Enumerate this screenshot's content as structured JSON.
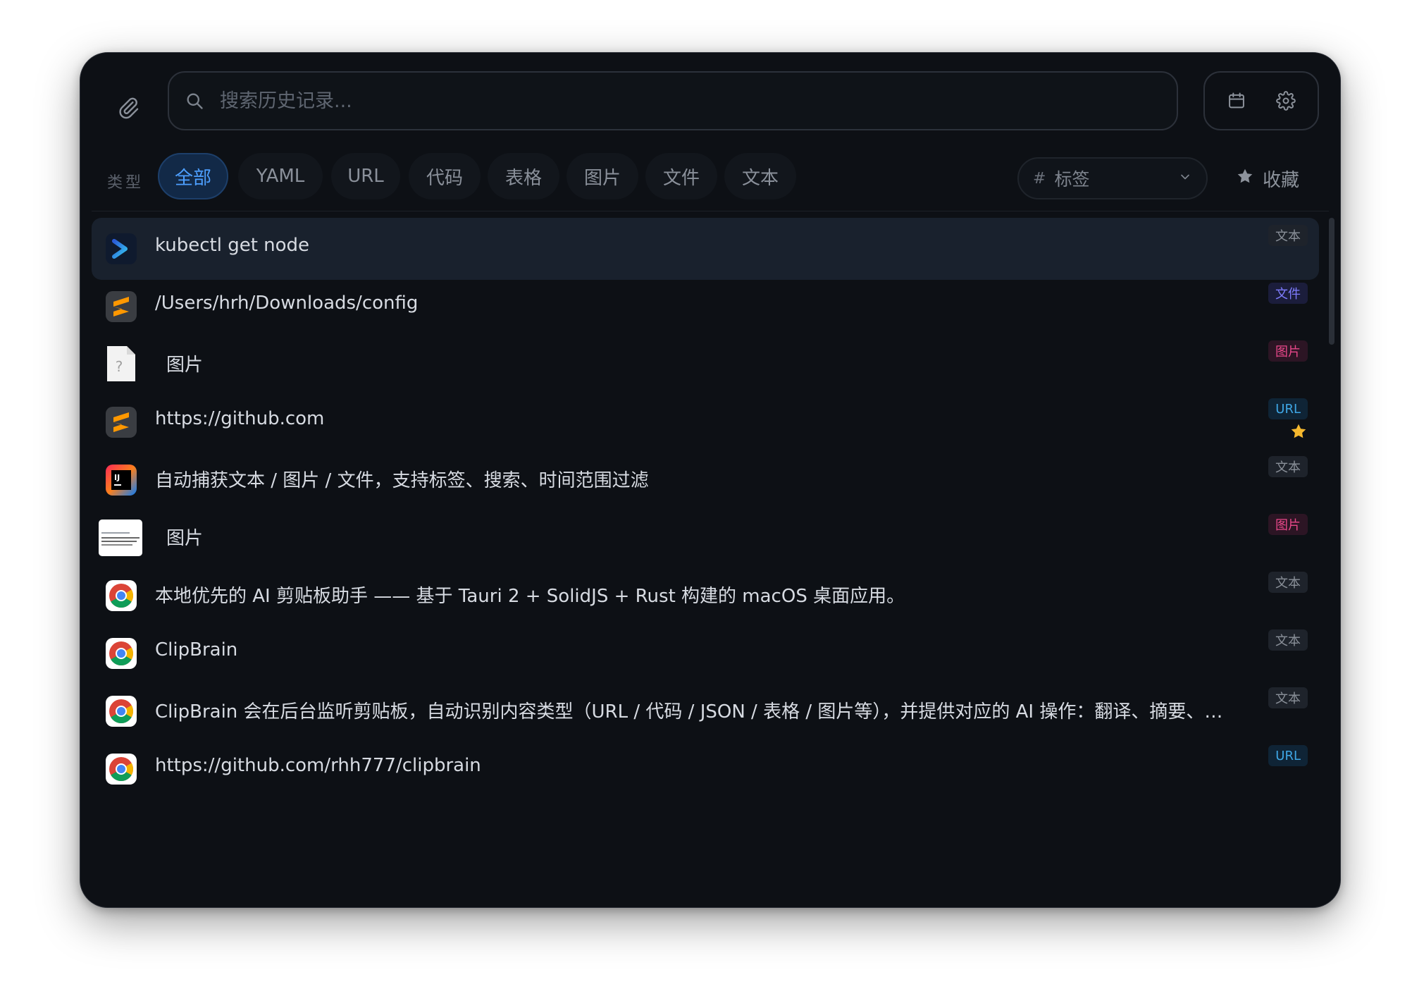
{
  "search": {
    "placeholder": "搜索历史记录..."
  },
  "filters": {
    "type_label": "类型",
    "chips": [
      "全部",
      "YAML",
      "URL",
      "代码",
      "表格",
      "图片",
      "文件",
      "文本"
    ],
    "active_index": 0,
    "tag_select_label": "标签",
    "tag_hash": "#",
    "favorites_label": "收藏"
  },
  "colors": {
    "window_bg": "#0d1015",
    "accent": "#4d9fff",
    "star": "#f5b82e",
    "badge_text": "#8a9099",
    "badge_file": "#7f7dff",
    "badge_image": "#e8488a",
    "badge_url": "#3fa7e6"
  },
  "items": [
    {
      "icon": "terminal-app-icon",
      "text": "kubectl get node",
      "badge": "文本",
      "badge_type": "text",
      "selected": true,
      "favorite": false
    },
    {
      "icon": "sublime-text-app-icon",
      "text": "/Users/hrh/Downloads/config",
      "badge": "文件",
      "badge_type": "file",
      "selected": false,
      "favorite": false
    },
    {
      "icon": "unknown-file-icon",
      "text": "图片",
      "badge": "图片",
      "badge_type": "image",
      "selected": false,
      "favorite": false
    },
    {
      "icon": "sublime-text-app-icon",
      "text": "https://github.com",
      "badge": "URL",
      "badge_type": "url",
      "selected": false,
      "favorite": true
    },
    {
      "icon": "intellij-app-icon",
      "text": "自动捕获文本 / 图片 / 文件，支持标签、搜索、时间范围过滤",
      "badge": "文本",
      "badge_type": "text",
      "selected": false,
      "favorite": false
    },
    {
      "icon": "image-thumbnail",
      "text": "图片",
      "badge": "图片",
      "badge_type": "image",
      "selected": false,
      "favorite": false
    },
    {
      "icon": "chrome-app-icon",
      "text": "本地优先的 AI 剪贴板助手 —— 基于 Tauri 2 + SolidJS + Rust 构建的 macOS 桌面应用。",
      "badge": "文本",
      "badge_type": "text",
      "selected": false,
      "favorite": false
    },
    {
      "icon": "chrome-app-icon",
      "text": "ClipBrain",
      "badge": "文本",
      "badge_type": "text",
      "selected": false,
      "favorite": false
    },
    {
      "icon": "chrome-app-icon",
      "text": "ClipBrain 会在后台监听剪贴板，自动识别内容类型（URL / 代码 / JSON / 表格 / 图片等），并提供对应的 AI 操作：翻译、摘要、格...",
      "badge": "文本",
      "badge_type": "text",
      "selected": false,
      "favorite": false
    },
    {
      "icon": "chrome-app-icon",
      "text": "https://github.com/rhh777/clipbrain",
      "badge": "URL",
      "badge_type": "url",
      "selected": false,
      "favorite": false
    }
  ]
}
